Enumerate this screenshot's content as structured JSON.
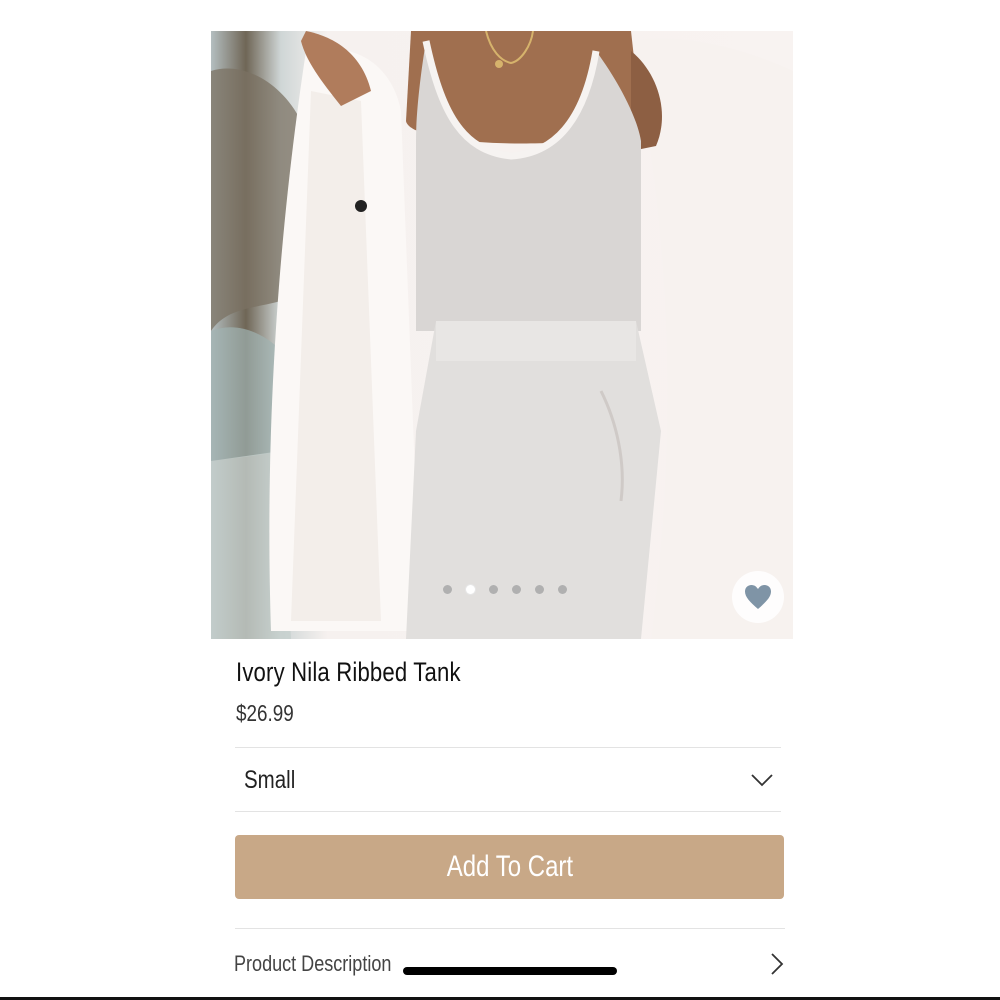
{
  "product": {
    "image_alt": "Model wearing ivory ribbed tank with grey joggers and white jacket",
    "title": "Ivory Nila Ribbed Tank",
    "price": "$26.99"
  },
  "carousel": {
    "total": 6,
    "active_index": 1
  },
  "favorite": {
    "icon": "heart-icon",
    "color": "#7f94a6"
  },
  "size_select": {
    "selected": "Small",
    "icon": "chevron-down-icon"
  },
  "add_to_cart": {
    "label": "Add To Cart",
    "color": "#c8a887"
  },
  "product_description": {
    "label": "Product Description",
    "icon": "chevron-right-icon"
  }
}
